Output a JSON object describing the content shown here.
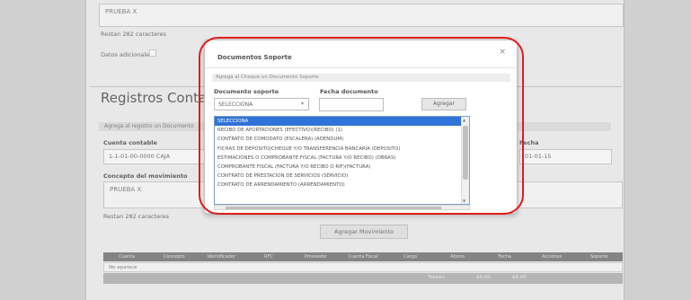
{
  "background": {
    "top_textarea_value": "PRUEBA X",
    "top_char_count": "Restan 282 caracteres",
    "client_label": "Datos adicionales",
    "section_title": "Registros Contables",
    "section_subtitle": "Agrega al registro un Documento",
    "account_label": "Cuenta contable",
    "account_value": "1-1-01-00-0000 CAJA",
    "concept_label": "Concepto del movimiento",
    "concept_value": "PRUEBA X",
    "right_label": "Fecha",
    "right_value": "01-01-15",
    "char_count": "Restan 282 caracteres",
    "add_doc_button": "Agregar Movimiento",
    "table_headers": [
      "Cuenta",
      "Concepto",
      "Identificador",
      "RFC",
      "Proveedor",
      "Cuenta Fiscal",
      "Cargo",
      "Abono",
      "Fecha",
      "Acciones",
      "Soporte"
    ],
    "table_empty": "No aparece",
    "footer_items": [
      "Totales",
      "$0.00",
      "$0.00"
    ]
  },
  "modal": {
    "title": "Documentos Soporte",
    "close_glyph": "×",
    "subtitle": "Agrega al Cheque un Documento Soporte",
    "support_label": "Documento soporte",
    "date_label": "Fecha documento",
    "select_value": "SELECCIONA",
    "date_value": "",
    "add_button": "Agregar",
    "options": [
      "SELECCIONA",
      "RECIBO DE APORTACIONES (EFECTIVO)(RECIBO) (1)",
      "CONTRATO DE COMODATO (ESCALERA) (ADENDUM)",
      "FICHAS DE DEPOSITO/CHEQUE Y/O TRANSFERENCIA BANCARIA (DEPOSITO)",
      "ESTIMACIONES O COMPROBANTE FISCAL (FACTURA Y/O RECIBO) (OBRAS)",
      "COMPROBANTE FISCAL (FACTURA Y/O RECIBO O RIF)(FACTURA)",
      "CONTRATO DE PRESTACION DE SERVICIOS (SERVICIO)",
      "CONTRATO DE ARRENDAMIENTO (ARRENDAMIENTO)"
    ],
    "selected_index": 0
  },
  "colors": {
    "highlight": "#e21b1b",
    "selected_option": "#2f73d8"
  }
}
